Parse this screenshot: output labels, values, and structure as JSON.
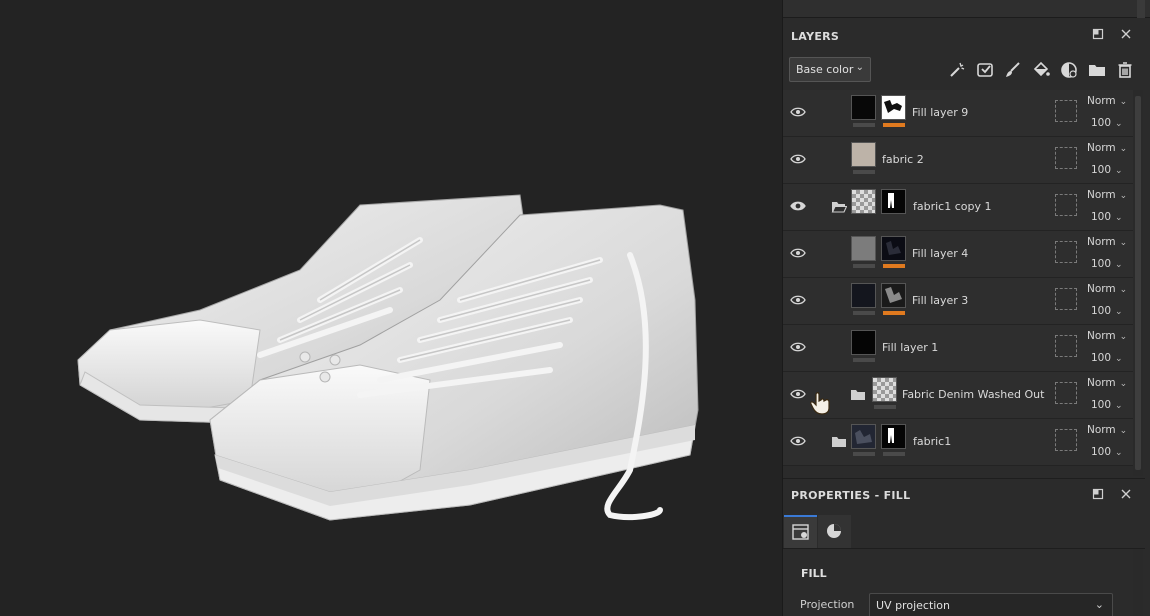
{
  "layers_panel": {
    "title": "LAYERS",
    "channel": "Base color",
    "tools": [
      "magic-wand-icon",
      "smart-mask-icon",
      "brush-icon",
      "fill-bucket-icon",
      "mask-icon",
      "folder-icon",
      "trash-icon"
    ],
    "layers": [
      {
        "name": "Fill layer 9",
        "blend": "Norm",
        "opacity": "100",
        "visible": true,
        "thumb": "black",
        "mask": "white-noise",
        "bar": "orange",
        "folder": false,
        "indent": 1
      },
      {
        "name": "fabric 2",
        "blend": "Norm",
        "opacity": "100",
        "visible": true,
        "thumb": "beige",
        "mask": "",
        "bar": "",
        "folder": false,
        "indent": 1
      },
      {
        "name": "fabric1 copy 1",
        "blend": "Norm",
        "opacity": "100",
        "visible": true,
        "thumb": "checker",
        "mask": "black-shoe",
        "bar": "",
        "folder": true,
        "indent": 1,
        "selected_eye": true
      },
      {
        "name": "Fill layer 4",
        "blend": "Norm",
        "opacity": "100",
        "visible": true,
        "thumb": "grey",
        "mask": "dark-noise",
        "bar": "orange",
        "folder": false,
        "indent": 1
      },
      {
        "name": "Fill layer 3",
        "blend": "Norm",
        "opacity": "100",
        "visible": true,
        "thumb": "navy",
        "mask": "dark-noise",
        "bar": "orange",
        "folder": false,
        "indent": 1
      },
      {
        "name": "Fill layer 1",
        "blend": "Norm",
        "opacity": "100",
        "visible": true,
        "thumb": "black",
        "mask": "",
        "bar": "",
        "folder": false,
        "indent": 0
      },
      {
        "name": "Fabric Denim Washed Out",
        "blend": "Norm",
        "opacity": "100",
        "visible": true,
        "thumb": "checker",
        "mask": "",
        "bar": "",
        "folder": true,
        "indent": 0,
        "cursor": true
      },
      {
        "name": "fabric1",
        "blend": "Norm",
        "opacity": "100",
        "visible": true,
        "thumb": "dark-noise",
        "mask": "black-shoe",
        "bar": "",
        "folder": true,
        "indent": -1
      }
    ]
  },
  "properties_panel": {
    "title": "PROPERTIES - FILL",
    "section": "FILL",
    "projection_label": "Projection",
    "projection_value": "UV projection"
  },
  "colors": {
    "accent_blue": "#3a7ad6",
    "orange_bar": "#e07a1f",
    "panel_bg": "#2b2b2b",
    "viewport_bg": "#232323"
  }
}
